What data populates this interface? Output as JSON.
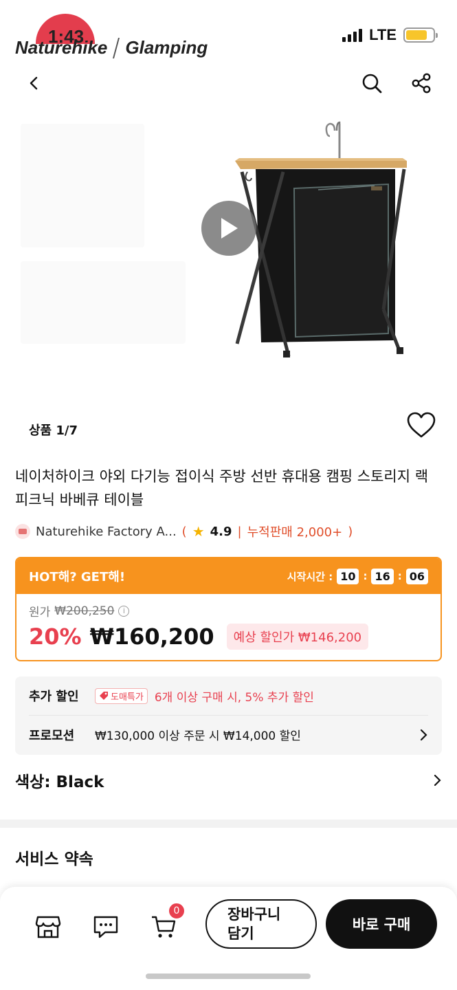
{
  "status_bar": {
    "time": "1:43",
    "network": "LTE"
  },
  "brand": {
    "left": "Naturehike",
    "right": "Glamping"
  },
  "nav": {
    "back": "chevron-left-icon",
    "search": "search-icon",
    "share": "share-icon"
  },
  "media": {
    "gallery_count": "상품 1/7"
  },
  "product": {
    "title": "네이처하이크 야외 다기능 접이식 주방 선반 휴대용 캠핑 스토리지 랙 피크닉 바베큐 테이블"
  },
  "seller": {
    "name": "Naturehike Factory A...",
    "paren_open": "(",
    "rating": "4.9",
    "sep": "|",
    "sold": "누적판매 2,000+",
    "paren_close": ")"
  },
  "hot_deal": {
    "title": "HOT해? GET해!",
    "timer_label": "시작시간 :",
    "hours": "10",
    "minutes": "16",
    "seconds": "06",
    "colon": ":",
    "original_label": "원가",
    "original_price": "₩200,250",
    "info_icon": "i",
    "discount": "20%",
    "price": "₩160,200",
    "expected": "예상 할인가 ₩146,200"
  },
  "extras": {
    "extra_label": "추가 할인",
    "wholesale_tag": "도매특가",
    "extra_text": "6개 이상 구매 시, 5% 추가 할인",
    "promo_label": "프로모션",
    "promo_text": "₩130,000 이상 주문 시 ₩14,000 할인"
  },
  "option": {
    "color": "색상: Black"
  },
  "service": {
    "title": "서비스 약속"
  },
  "bottom": {
    "cart_count": "0",
    "add_to_cart": "장바구니 담기",
    "buy_now": "바로 구매"
  },
  "colors": {
    "accent": "#f7931e",
    "sale_red": "#e8404f",
    "dark": "#111111"
  }
}
